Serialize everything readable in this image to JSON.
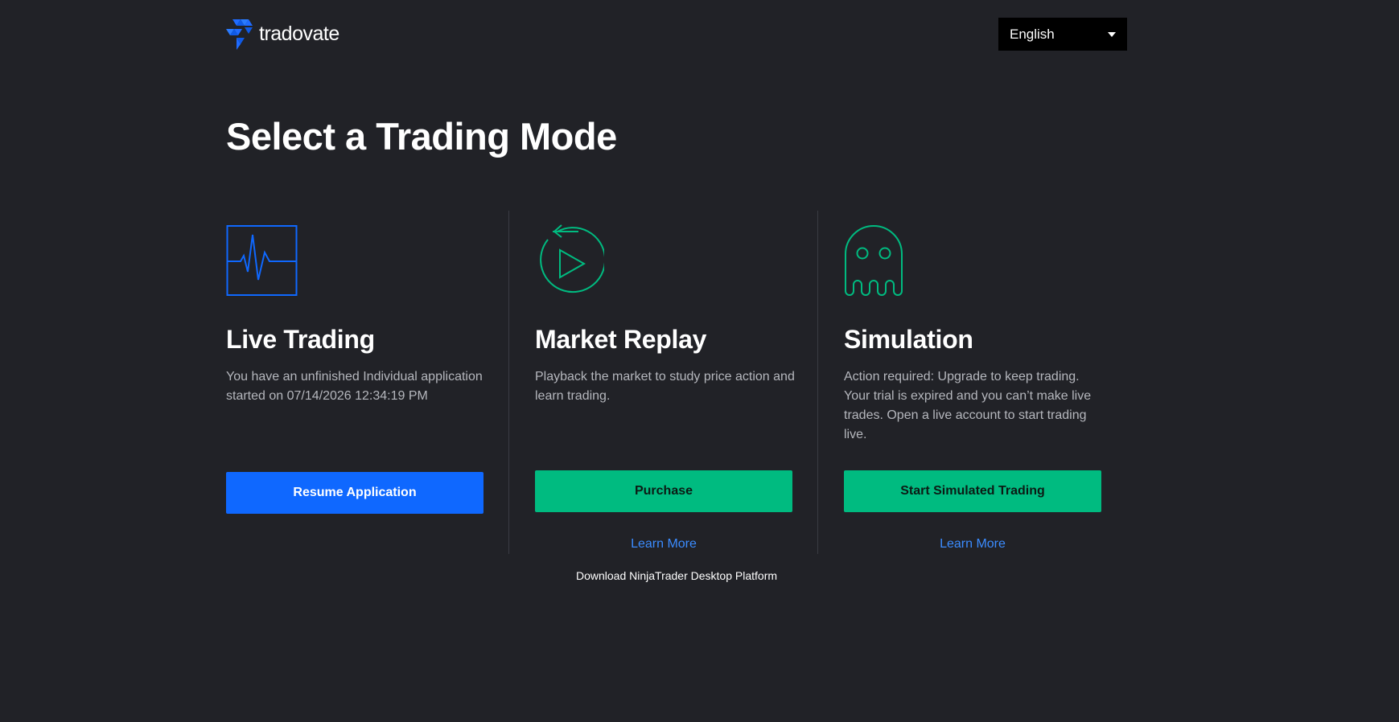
{
  "header": {
    "logo_text": "tradovate",
    "logo_icon": "tradovate-triangles-icon",
    "language": {
      "selected": "English",
      "icon": "caret-down-icon"
    }
  },
  "main": {
    "title": "Select a Trading Mode",
    "cards": [
      {
        "icon": "heartbeat-monitor-icon",
        "title": "Live Trading",
        "description": "You have an unfinished Individual application started on 07/14/2026 12:34:19 PM",
        "button_label": "Resume Application",
        "learn_more": ""
      },
      {
        "icon": "replay-play-icon",
        "title": "Market Replay",
        "description": "Playback the market to study price action and learn trading.",
        "button_label": "Purchase",
        "learn_more": "Learn More"
      },
      {
        "icon": "ghost-icon",
        "title": "Simulation",
        "description": "Action required: Upgrade to keep trading. Your trial is expired and you can’t make live trades. Open a live account to start trading live.",
        "button_label": "Start Simulated Trading",
        "learn_more": "Learn More"
      }
    ],
    "download_link": "Download NinjaTrader Desktop Platform"
  },
  "colors": {
    "background": "#212227",
    "primary_blue": "#0f68ff",
    "accent_green": "#00bb80",
    "link_blue": "#3b8cff",
    "muted_text": "#b5b7bd"
  }
}
